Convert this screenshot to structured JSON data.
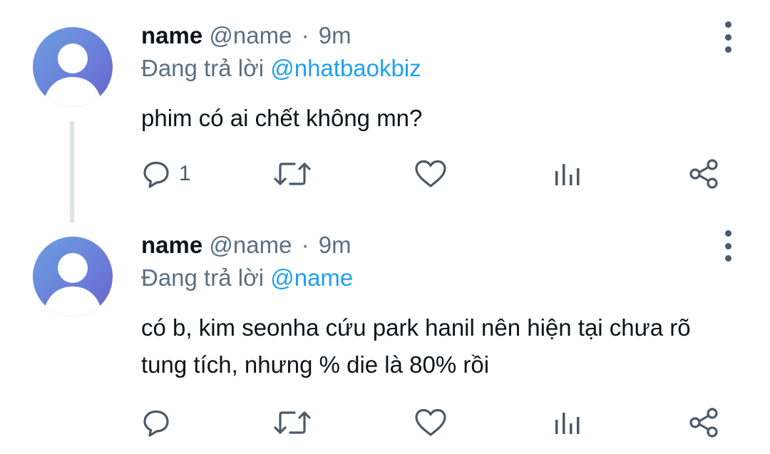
{
  "tweets": [
    {
      "display_name": "name",
      "handle": "@name",
      "separator": "·",
      "time": "9m",
      "reply_prefix": "Đang trả lời",
      "reply_to": "@nhatbaokbiz",
      "text": "phim có ai chết không mn?",
      "reply_count": "1",
      "icons": [
        "avatar-icon",
        "more-vertical-icon",
        "reply-icon",
        "retweet-icon",
        "like-icon",
        "analytics-icon",
        "share-icon"
      ]
    },
    {
      "display_name": "name",
      "handle": "@name",
      "separator": "·",
      "time": "9m",
      "reply_prefix": "Đang trả lời",
      "reply_to": "@name",
      "text": "có b, kim seonha cứu park hanil nên hiện tại chưa rõ tung tích, nhưng % die là 80% rồi",
      "reply_count": "",
      "icons": [
        "avatar-icon",
        "more-vertical-icon",
        "reply-icon",
        "retweet-icon",
        "like-icon",
        "analytics-icon",
        "share-icon"
      ]
    }
  ],
  "colors": {
    "mention": "#1da1f2",
    "secondary_text": "#5b7083",
    "icon": "#4b5a68",
    "thread_line": "#dfe3e6",
    "avatar_gradient": [
      "#6c9fe0",
      "#6b64c8"
    ]
  }
}
